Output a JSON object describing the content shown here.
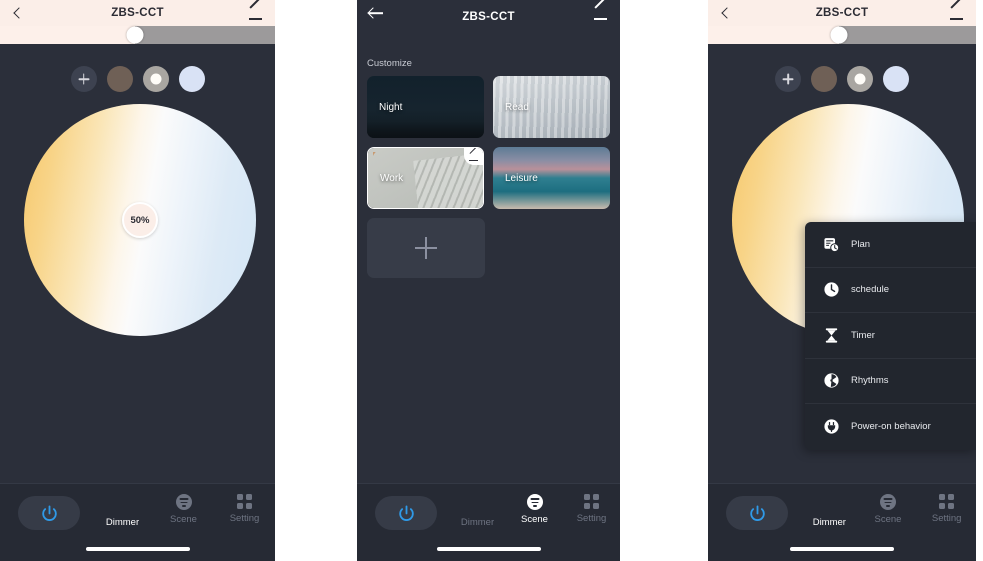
{
  "app": {
    "device_name": "ZBS-CCT",
    "accent_blue": "#2f9ae8",
    "panel_bg": "#2b2f3a",
    "header_light_bg": "#fbeee8"
  },
  "header": {
    "title": "ZBS-CCT",
    "back_icon": "chevron-left-icon",
    "edit_icon": "pencil-icon"
  },
  "brightness_slider": {
    "value_percent": 49,
    "track_color": "#9c9a9b",
    "fill_color": "#fdf0ea"
  },
  "swatches": [
    {
      "name": "add-color-swatch",
      "color": "#3d4250",
      "type": "add"
    },
    {
      "name": "color-swatch-brown",
      "color": "#6f6056",
      "type": "color"
    },
    {
      "name": "color-swatch-selected",
      "color": "#a9a6a1",
      "type": "selected"
    },
    {
      "name": "color-swatch-cool-white",
      "color": "#d9e2f5",
      "type": "color"
    }
  ],
  "wheel": {
    "brightness_label": "50%",
    "warm_color": "#f6c76a",
    "cool_color": "#d3e6f5"
  },
  "nav": {
    "power_icon": "power-icon",
    "items": [
      {
        "label": "Dimmer",
        "icon": "bulb-icon",
        "active": true
      },
      {
        "label": "Scene",
        "icon": "scene-icon",
        "active": false
      },
      {
        "label": "Setting",
        "icon": "grid-icon",
        "active": false
      }
    ],
    "items_scene_panel": [
      {
        "label": "Dimmer",
        "icon": "bulb-icon",
        "active": false
      },
      {
        "label": "Scene",
        "icon": "scene-icon",
        "active": true
      },
      {
        "label": "Setting",
        "icon": "grid-icon",
        "active": false
      }
    ]
  },
  "scene_page": {
    "section_label": "Customize",
    "cards": [
      {
        "label": "Night",
        "art": "night",
        "selected": false
      },
      {
        "label": "Read",
        "art": "read",
        "selected": false
      },
      {
        "label": "Work",
        "art": "work",
        "selected": true
      },
      {
        "label": "Leisure",
        "art": "leisure",
        "selected": false
      }
    ],
    "add_card_icon": "plus-icon"
  },
  "menu": {
    "items": [
      {
        "label": "Plan",
        "icon": "calendar-clock-icon"
      },
      {
        "label": "schedule",
        "icon": "clock-icon"
      },
      {
        "label": "Timer",
        "icon": "hourglass-icon"
      },
      {
        "label": "Rhythms",
        "icon": "rhythms-icon"
      },
      {
        "label": "Power-on behavior",
        "icon": "plug-icon"
      }
    ]
  }
}
